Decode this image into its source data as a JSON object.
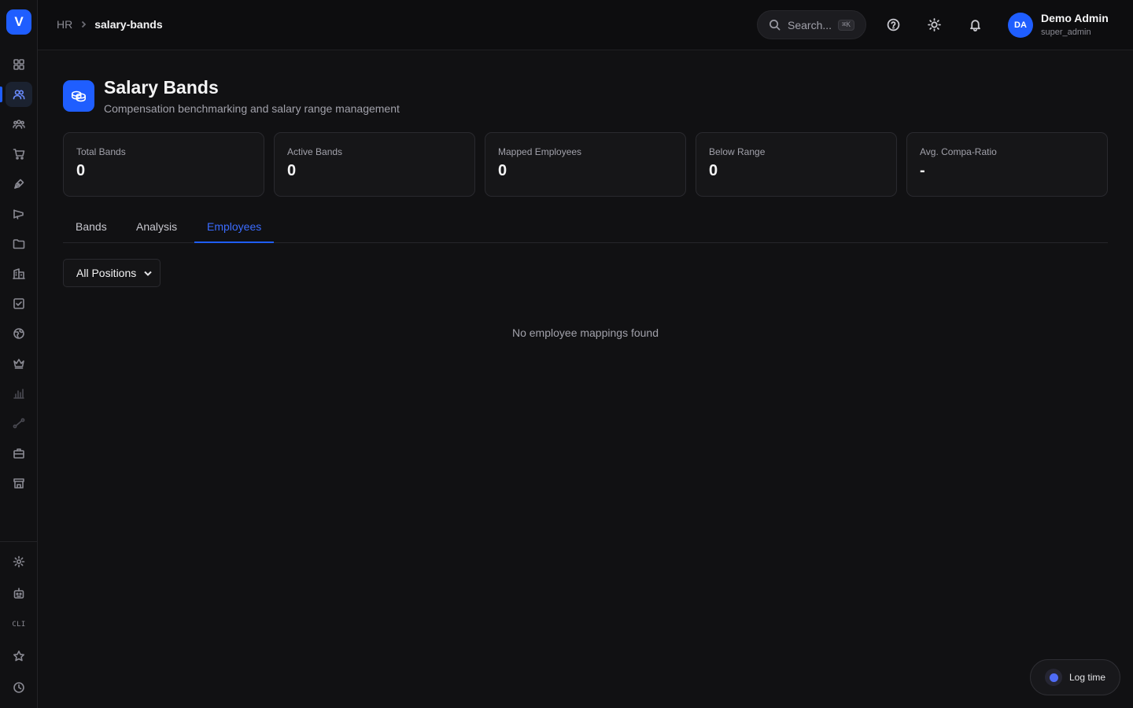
{
  "app": {
    "logo_letter": "V"
  },
  "sidebar": {
    "items": [
      {
        "icon": "dashboard-icon"
      },
      {
        "icon": "users-icon",
        "active": true
      },
      {
        "icon": "team-icon"
      },
      {
        "icon": "cart-icon"
      },
      {
        "icon": "pen-tool-icon"
      },
      {
        "icon": "megaphone-icon"
      },
      {
        "icon": "folder-icon"
      },
      {
        "icon": "building-icon"
      },
      {
        "icon": "checkbox-icon"
      },
      {
        "icon": "globe-icon"
      },
      {
        "icon": "crown-icon"
      },
      {
        "icon": "bar-chart-icon"
      },
      {
        "icon": "workflow-icon"
      },
      {
        "icon": "briefcase-icon"
      },
      {
        "icon": "store-icon"
      }
    ],
    "bottom": {
      "settings_icon": "settings-icon",
      "bot_icon": "bot-icon",
      "cli_label": "CLI",
      "star_icon": "star-icon",
      "clock_icon": "clock-icon"
    }
  },
  "header": {
    "breadcrumb": [
      "HR",
      "salary-bands"
    ],
    "search_placeholder": "Search...",
    "search_shortcut": "⌘K",
    "user": {
      "initials": "DA",
      "name": "Demo Admin",
      "role": "super_admin"
    }
  },
  "page": {
    "title": "Salary Bands",
    "subtitle": "Compensation benchmarking and salary range management",
    "icon": "coins-icon"
  },
  "stats": [
    {
      "label": "Total Bands",
      "value": "0"
    },
    {
      "label": "Active Bands",
      "value": "0"
    },
    {
      "label": "Mapped Employees",
      "value": "0"
    },
    {
      "label": "Below Range",
      "value": "0"
    },
    {
      "label": "Avg. Compa-Ratio",
      "value": "-"
    }
  ],
  "tabs": [
    {
      "label": "Bands"
    },
    {
      "label": "Analysis"
    },
    {
      "label": "Employees",
      "active": true
    }
  ],
  "filter": {
    "selected": "All Positions"
  },
  "empty_state": "No employee mappings found",
  "log_time": {
    "label": "Log time"
  },
  "colors": {
    "accent": "#1f5eff",
    "background": "#111113",
    "card": "#161618"
  }
}
